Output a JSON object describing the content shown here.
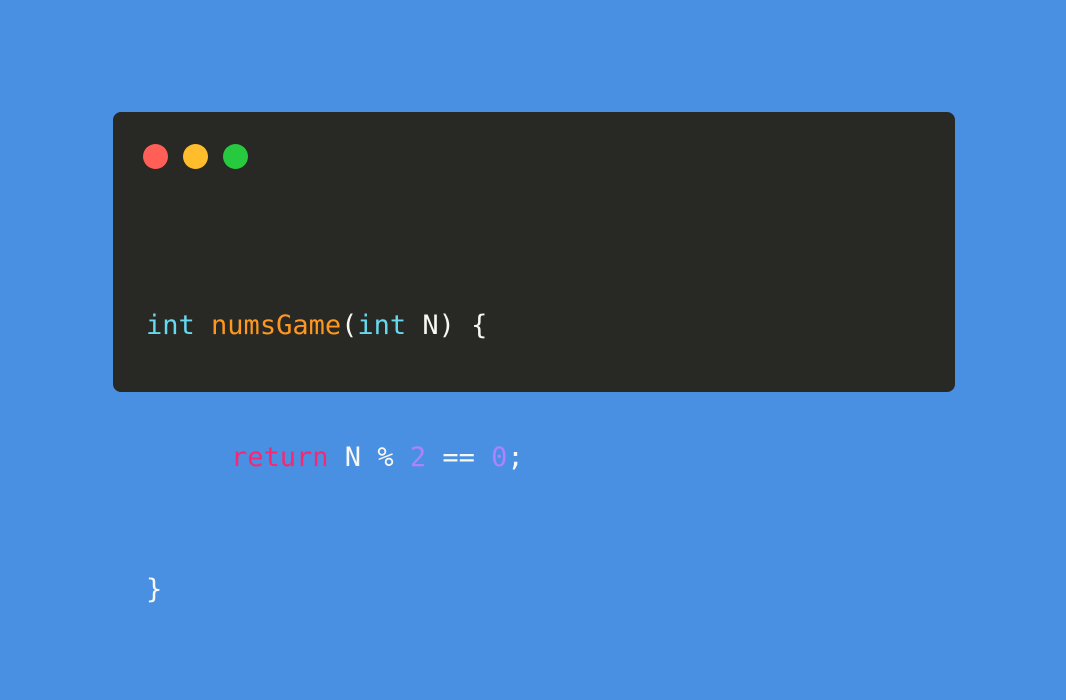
{
  "window": {
    "controls": {
      "close_color": "#ff5f56",
      "minimize_color": "#ffbd2e",
      "maximize_color": "#27c93f"
    }
  },
  "code": {
    "language": "c",
    "lines": [
      "int numsGame(int N) {",
      "     return N % 2 == 0;",
      "}"
    ],
    "tokens": {
      "line1": {
        "type1": "int",
        "space1": " ",
        "function_name": "numsGame",
        "paren_open": "(",
        "type2": "int",
        "param": " N",
        "paren_close_brace": ") {"
      },
      "line2": {
        "keyword": "return",
        "var": " N ",
        "operator_mod": "% ",
        "num1": "2",
        "operator_eq": " == ",
        "num2": "0",
        "semicolon": ";"
      },
      "line3": {
        "brace": "}"
      }
    }
  },
  "colors": {
    "background": "#4a90e2",
    "window_bg": "#282824",
    "type_keyword": "#66d9ef",
    "function_name": "#fd971f",
    "return_keyword": "#f92672",
    "number": "#ae81ff",
    "plain_text": "#f8f8f2"
  }
}
